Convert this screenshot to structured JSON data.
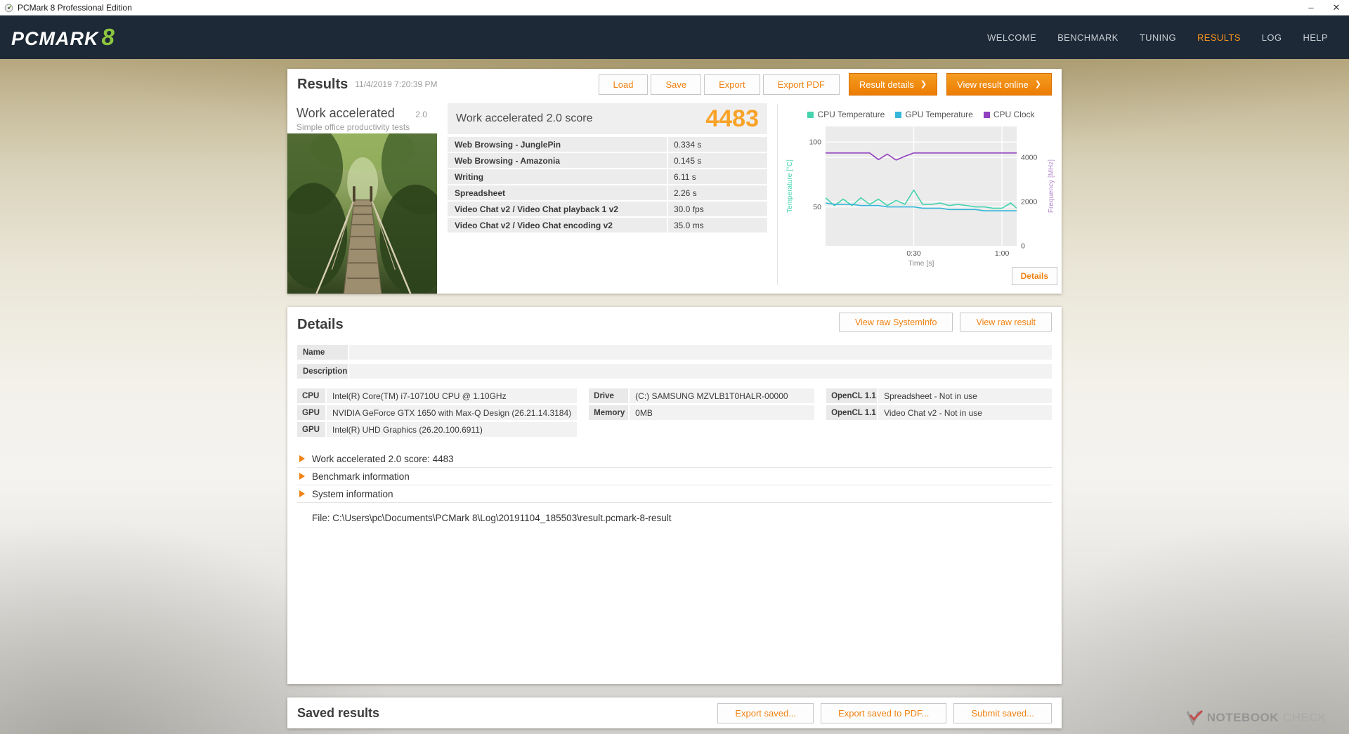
{
  "window": {
    "title": "PCMark 8 Professional Edition",
    "minimize": "–",
    "close": "✕"
  },
  "navbar": {
    "logo_text": "PCMARK",
    "logo_number": "8",
    "items": [
      {
        "label": "WELCOME",
        "active": false
      },
      {
        "label": "BENCHMARK",
        "active": false
      },
      {
        "label": "TUNING",
        "active": false
      },
      {
        "label": "RESULTS",
        "active": true
      },
      {
        "label": "LOG",
        "active": false
      },
      {
        "label": "HELP",
        "active": false
      }
    ]
  },
  "results_panel": {
    "title": "Results",
    "timestamp": "11/4/2019 7:20:39 PM",
    "buttons": {
      "load": "Load",
      "save": "Save",
      "export": "Export",
      "export_pdf": "Export PDF",
      "result_details": "Result details",
      "view_result_online": "View result online",
      "chevron": "❯"
    },
    "test": {
      "name": "Work accelerated",
      "version": "2.0",
      "subtitle": "Simple office productivity tests"
    },
    "score_label": "Work accelerated 2.0 score",
    "score": "4483",
    "metrics": [
      {
        "name": "Web Browsing - JunglePin",
        "value": "0.334 s"
      },
      {
        "name": "Web Browsing - Amazonia",
        "value": "0.145 s"
      },
      {
        "name": "Writing",
        "value": "6.11 s"
      },
      {
        "name": "Spreadsheet",
        "value": "2.26 s"
      },
      {
        "name": "Video Chat v2 / Video Chat playback 1 v2",
        "value": "30.0 fps"
      },
      {
        "name": "Video Chat v2 / Video Chat encoding v2",
        "value": "35.0 ms"
      }
    ],
    "details_button": "Details"
  },
  "chart_data": {
    "type": "line",
    "title": "",
    "xlabel": "Time [s]",
    "x_range": [
      0,
      65
    ],
    "x_ticks": [
      {
        "t": 30,
        "label": "0:30"
      },
      {
        "t": 60,
        "label": "1:00"
      }
    ],
    "grid": true,
    "legend_position": "top",
    "axes": {
      "left": {
        "label": "Temperature [°C]",
        "range": [
          20,
          112
        ],
        "ticks": [
          50,
          100
        ],
        "color": "#45d3ae"
      },
      "right": {
        "label": "Frequency [MHz]",
        "range": [
          0,
          5400
        ],
        "ticks": [
          0,
          2000,
          4000
        ],
        "color": "#b48ccd"
      }
    },
    "x": [
      0,
      3,
      6,
      9,
      12,
      15,
      18,
      21,
      24,
      27,
      30,
      33,
      36,
      39,
      42,
      45,
      48,
      51,
      54,
      57,
      60,
      63,
      65
    ],
    "series": [
      {
        "name": "CPU Temperature",
        "axis": "left",
        "color": "#45d3ae",
        "values": [
          57,
          51,
          56,
          51,
          57,
          52,
          56,
          51,
          55,
          52,
          63,
          52,
          52,
          53,
          51,
          52,
          51,
          50,
          50,
          49,
          49,
          53,
          49
        ]
      },
      {
        "name": "GPU Temperature",
        "axis": "left",
        "color": "#35b6d9",
        "values": [
          53,
          52,
          52,
          52,
          51,
          51,
          51,
          50,
          50,
          50,
          50,
          49,
          49,
          49,
          48,
          48,
          48,
          48,
          47,
          47,
          47,
          47,
          47
        ]
      },
      {
        "name": "CPU Clock",
        "axis": "right",
        "color": "#9140bf",
        "values": [
          4200,
          4200,
          4200,
          4200,
          4200,
          4200,
          3900,
          4150,
          3880,
          4050,
          4200,
          4200,
          4200,
          4200,
          4200,
          4200,
          4200,
          4200,
          4200,
          4200,
          4200,
          4200,
          4200
        ]
      }
    ]
  },
  "details_panel": {
    "title": "Details",
    "buttons": {
      "view_raw_systeminfo": "View raw SystemInfo",
      "view_raw_result": "View raw result"
    },
    "name_label": "Name",
    "name_value": "",
    "description_label": "Description",
    "description_value": "",
    "spec_columns": [
      {
        "rows": [
          {
            "label": "CPU",
            "value": "Intel(R) Core(TM) i7-10710U CPU @ 1.10GHz"
          },
          {
            "label": "GPU",
            "value": "NVIDIA GeForce GTX 1650 with Max-Q Design (26.21.14.3184)"
          },
          {
            "label": "GPU",
            "value": "Intel(R) UHD Graphics (26.20.100.6911)"
          }
        ]
      },
      {
        "rows": [
          {
            "label": "Drive",
            "value": "(C:) SAMSUNG MZVLB1T0HALR-00000"
          },
          {
            "label": "Memory",
            "value": "0MB"
          }
        ]
      },
      {
        "rows": [
          {
            "label": "OpenCL 1.1",
            "value": "Spreadsheet - Not in use"
          },
          {
            "label": "OpenCL 1.1",
            "value": "Video Chat v2 - Not in use"
          }
        ]
      }
    ],
    "expanders": [
      "Work accelerated 2.0 score: 4483",
      "Benchmark information",
      "System information"
    ],
    "file_line": "File: C:\\Users\\pc\\Documents\\PCMark 8\\Log\\20191104_185503\\result.pcmark-8-result"
  },
  "saved_panel": {
    "title": "Saved results",
    "buttons": [
      "Export saved...",
      "Export saved to PDF...",
      "Submit saved..."
    ]
  },
  "watermark": {
    "notebook": "NOTEBOOK",
    "check": "CHECK"
  },
  "colors": {
    "accent_orange": "#ef8212",
    "score_orange": "#f8a227",
    "header_navy": "#1d2936",
    "cpu_temp": "#45d3ae",
    "gpu_temp": "#35b6d9",
    "cpu_clock": "#9140bf",
    "logo_green": "#8dc63f"
  }
}
